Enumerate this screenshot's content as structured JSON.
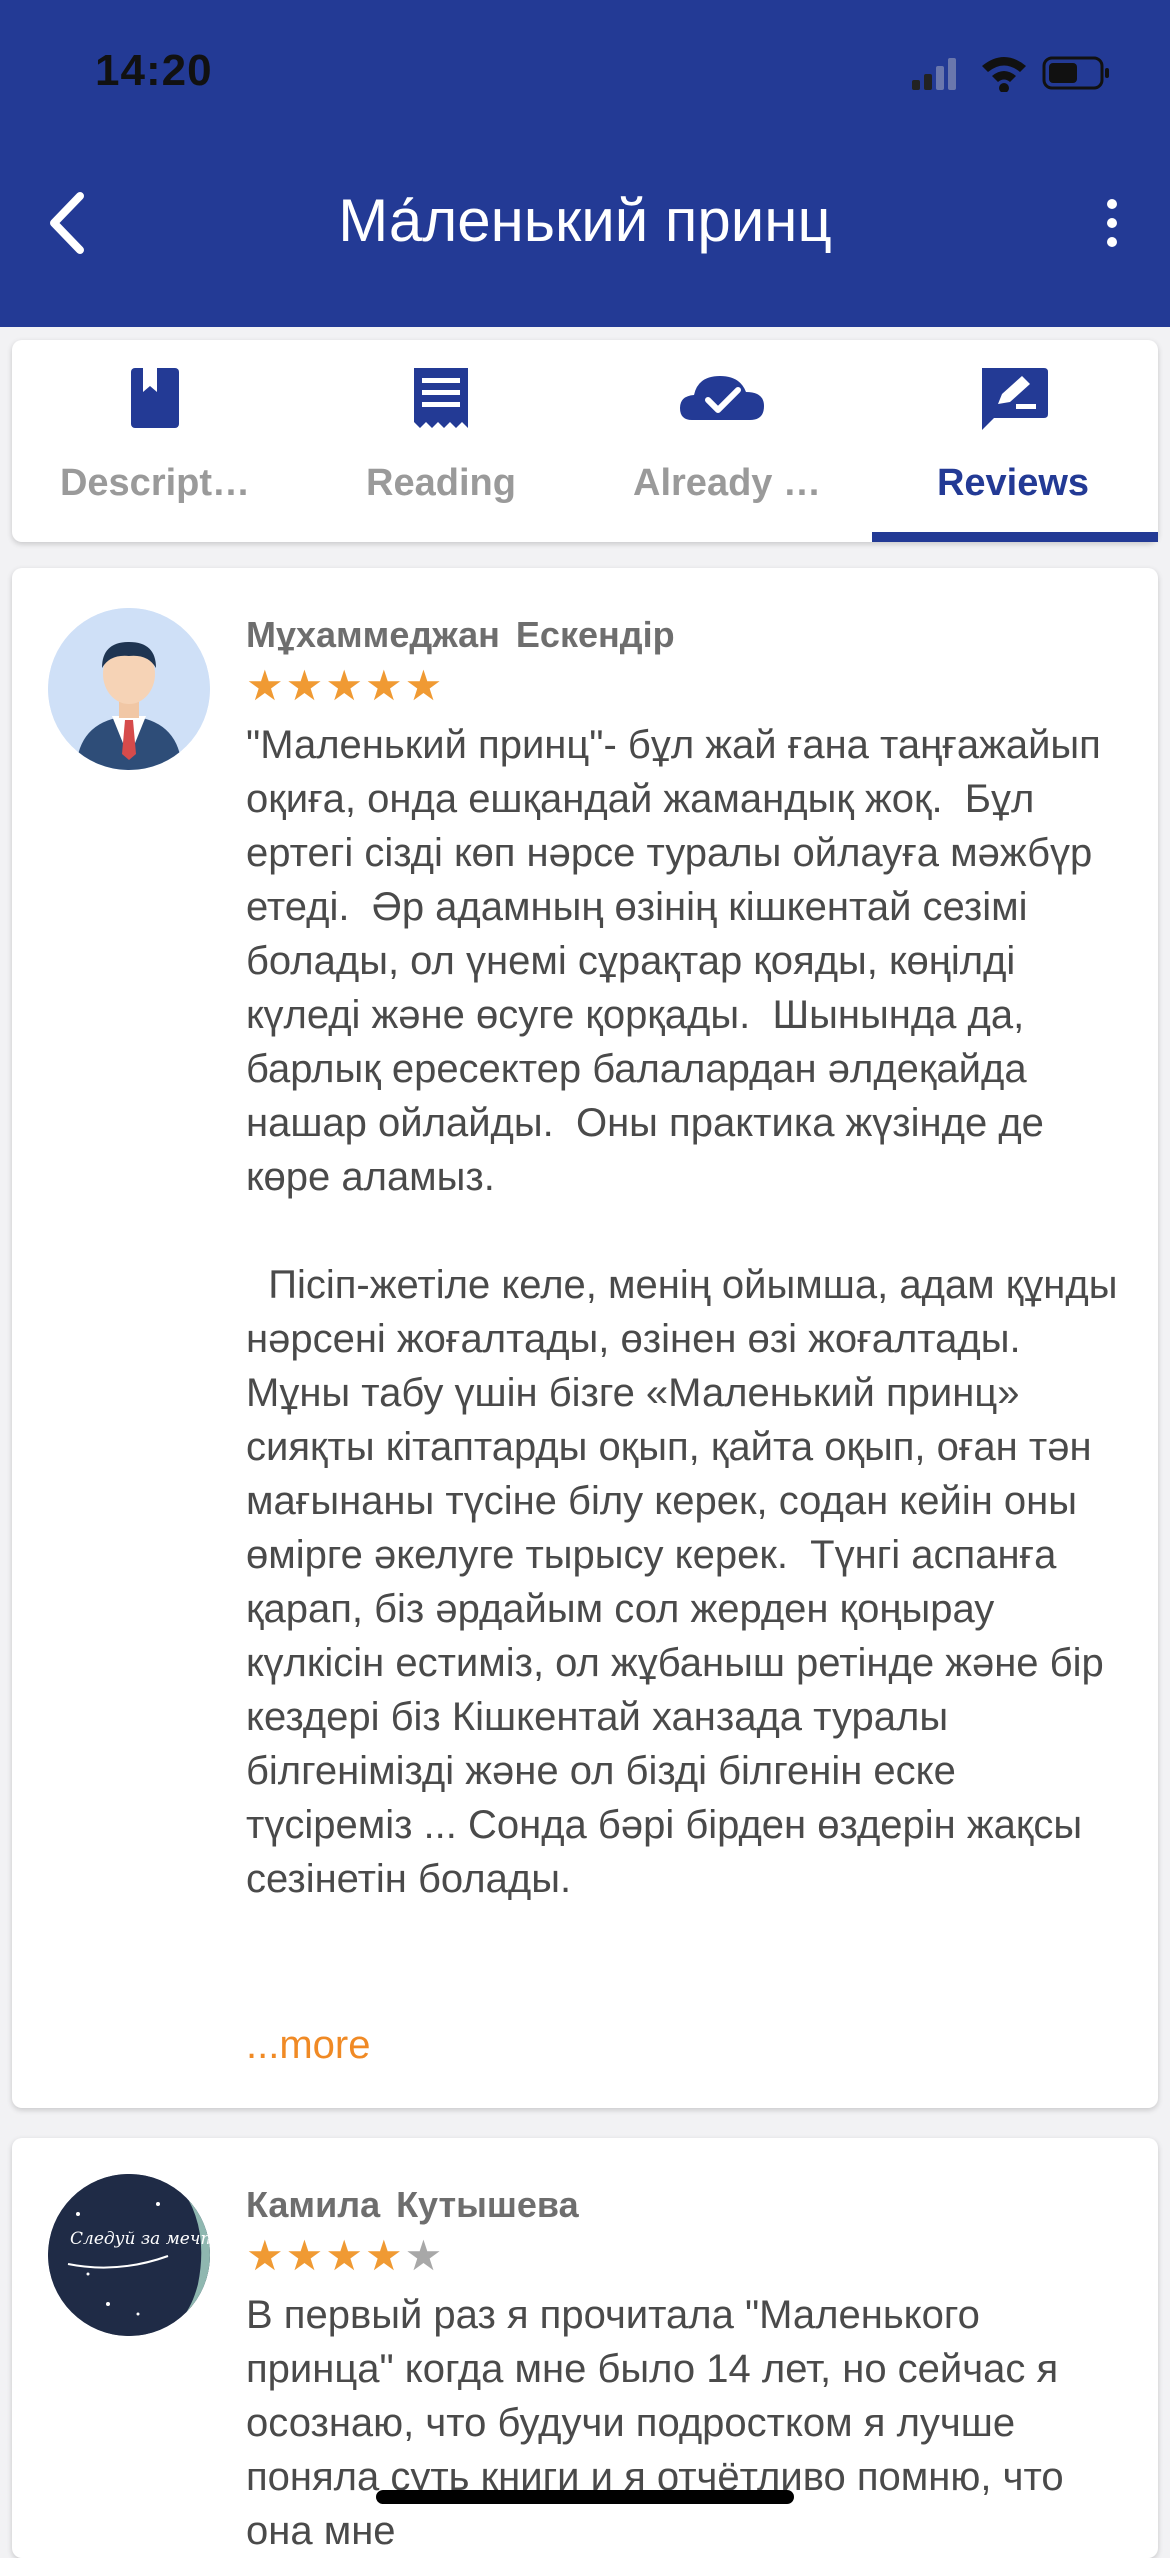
{
  "status_bar": {
    "time": "14:20"
  },
  "header": {
    "title": "Ма́ленький принц"
  },
  "tabs": [
    {
      "label": "Descript…",
      "icon": "book-icon"
    },
    {
      "label": "Reading",
      "icon": "receipt-icon"
    },
    {
      "label": "Already …",
      "icon": "cloud-check-icon"
    },
    {
      "label": "Reviews",
      "icon": "edit-comment-icon",
      "active": true
    }
  ],
  "colors": {
    "primary": "#233a95",
    "accent": "#f09a33",
    "more_link": "#f08a25"
  },
  "reviews": [
    {
      "name": "Мұхаммеджан  Ескендір",
      "rating": 5,
      "text": "\"Маленький принц\"- бұл жай ғана таңғажайып оқиға, онда ешқандай жамандық жоқ.  Бұл ертегі сізді көп нәрсе туралы ойлауға мәжбүр етеді.  Әр адамның өзінің кішкентай сезімі болады, ол үнемі сұрақтар қояды, көңілді күледі және өсуге қорқады.  Шынында да, барлық ересектер балалардан әлдеқайда нашар ойлайды.  Оны практика жүзінде де көре аламыз.\n\n  Пісіп-жетіле келе, менің ойымша, адам құнды нәрсені жоғалтады, өзінен өзі жоғалтады.  Мұны табу үшін бізге «Маленький принц» сияқты кітаптарды оқып, қайта оқып, оған тән мағынаны түсіне білу керек, содан кейін оны өмірге әкелуге тырысу керек.  Түнгі аспанға қарап, біз әрдайым сол жерден қоңырау күлкісін естиміз, ол жұбаныш ретінде және бір кездері біз Кішкентай ханзада туралы білгенімізді және ол бізді білгенін еске түсіреміз ... Сонда бәрі бірден өздерін жақсы сезінетін болады.",
      "more": "...more"
    },
    {
      "name": "Камила  Кутышева",
      "rating": 4,
      "avatar_text": "Следуй за мечтами",
      "text": "В первый раз я прочитала \"Маленького принца\" когда мне было 14 лет, но сейчас я осознаю, что будучи подростком я лучше поняла суть книги и я отчётливо помню, что она мне"
    }
  ]
}
